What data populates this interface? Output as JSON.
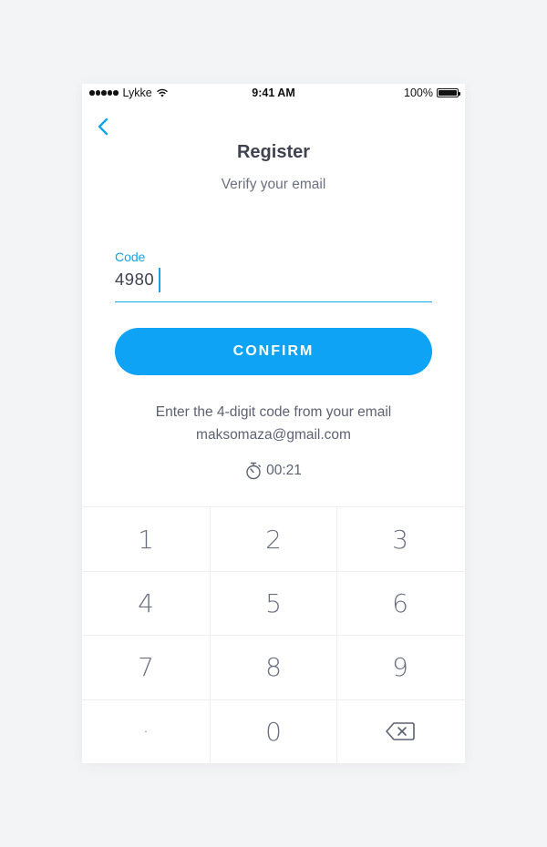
{
  "status_bar": {
    "carrier": "Lykke",
    "time": "9:41 AM",
    "battery": "100%"
  },
  "header": {
    "title": "Register",
    "subtitle": "Verify your email"
  },
  "code_field": {
    "label": "Code",
    "value": "4980"
  },
  "confirm_button": {
    "label": "CONFIRM"
  },
  "info": {
    "hint": "Enter the 4-digit code from your email",
    "email": "maksomaza@gmail.com",
    "timer": "00:21"
  },
  "keypad": {
    "keys": [
      "1",
      "2",
      "3",
      "4",
      "5",
      "6",
      "7",
      "8",
      "9",
      ".",
      "0"
    ],
    "backspace_icon": "backspace-icon"
  },
  "colors": {
    "accent": "#13a4ec",
    "button": "#0ea3f5",
    "text": "#3f4350",
    "muted": "#6b7080"
  }
}
